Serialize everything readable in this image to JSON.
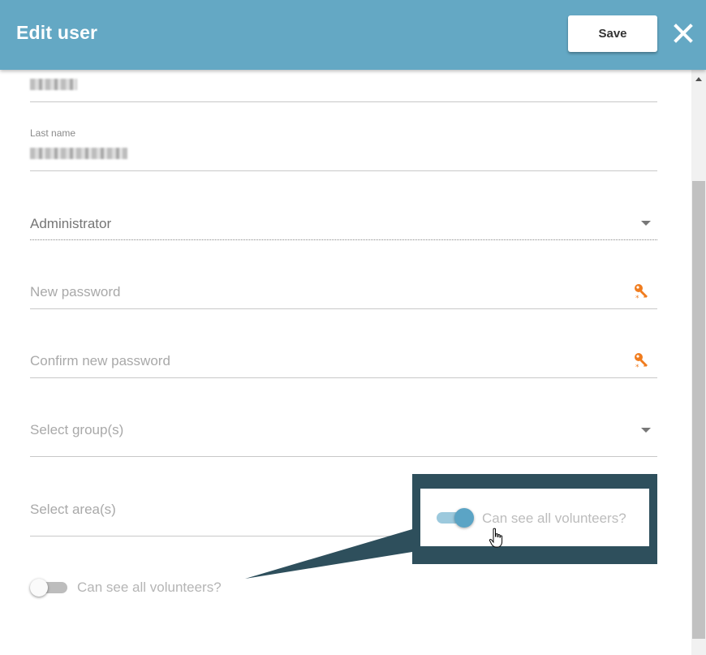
{
  "header": {
    "title": "Edit user",
    "save_label": "Save",
    "close_icon": "close-icon"
  },
  "form": {
    "first_name": {
      "value_redacted": true
    },
    "last_name": {
      "label": "Last name",
      "value_redacted": true
    },
    "role": {
      "value": "Administrator",
      "icon": "chevron-down-icon"
    },
    "new_password": {
      "placeholder": "New password",
      "icon": "key-icon"
    },
    "confirm_password": {
      "placeholder": "Confirm new password",
      "icon": "key-icon"
    },
    "groups": {
      "placeholder": "Select group(s)",
      "icon": "chevron-down-icon"
    },
    "areas": {
      "placeholder": "Select area(s)"
    },
    "volunteers_toggle": {
      "label": "Can see all volunteers?",
      "checked": false
    }
  },
  "callout": {
    "toggle_label": "Can see all volunteers?",
    "checked": true,
    "cursor_icon": "hand-pointer-icon"
  },
  "colors": {
    "header_bg": "#64a8c4",
    "key_icon": "#f07c1e",
    "callout_bg": "#2e4f5c",
    "toggle_on": "#5ba4c5"
  }
}
